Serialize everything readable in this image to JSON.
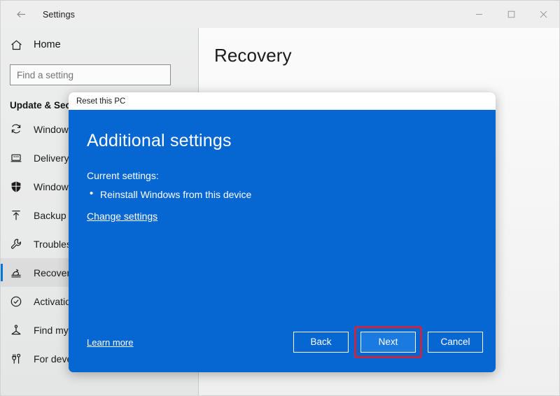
{
  "window": {
    "title": "Settings",
    "back_icon": "back-arrow-icon",
    "caption": {
      "minimize": "minimize-icon",
      "maximize": "maximize-icon",
      "close": "close-icon"
    }
  },
  "sidebar": {
    "home": {
      "label": "Home",
      "icon": "home-icon"
    },
    "search": {
      "value": "",
      "placeholder": "Find a setting"
    },
    "section_title": "Update & Security",
    "items": [
      {
        "label": "Windows",
        "icon": "windows-update-sync-icon",
        "selected": false
      },
      {
        "label": "Delivery O",
        "icon": "delivery-optimization-icon",
        "selected": false
      },
      {
        "label": "Windows",
        "icon": "windows-security-shield-icon",
        "selected": false
      },
      {
        "label": "Backup",
        "icon": "backup-upload-icon",
        "selected": false
      },
      {
        "label": "Troublesh",
        "icon": "troubleshoot-wrench-icon",
        "selected": false
      },
      {
        "label": "Recovery",
        "icon": "recovery-icon",
        "selected": true
      },
      {
        "label": "Activation",
        "icon": "activation-check-icon",
        "selected": false
      },
      {
        "label": "Find my device",
        "icon": "find-my-device-icon",
        "selected": false
      },
      {
        "label": "For developers",
        "icon": "for-developers-icon",
        "selected": false
      }
    ]
  },
  "main": {
    "page_title": "Recovery"
  },
  "dialog": {
    "title": "Reset this PC",
    "heading": "Additional settings",
    "subheading": "Current settings:",
    "settings_list": [
      "Reinstall Windows from this device"
    ],
    "change_settings_link": "Change settings",
    "learn_more_link": "Learn more",
    "buttons": {
      "back": "Back",
      "next": "Next",
      "cancel": "Cancel"
    },
    "accent_color": "#0667d2",
    "primary_button_color": "#1b7ae0",
    "highlight_color": "#c62842"
  }
}
